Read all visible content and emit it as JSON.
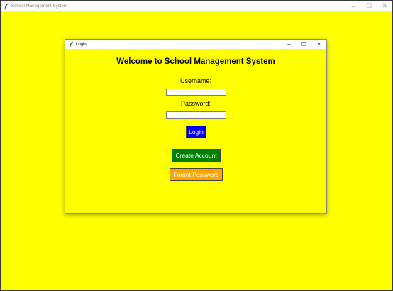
{
  "main_window": {
    "title": "School Management System",
    "controls": [
      "–",
      "☐",
      "✕"
    ]
  },
  "login_window": {
    "title": "Login",
    "controls": [
      "–",
      "☐",
      "✕"
    ],
    "heading": "Welcome to School Management System",
    "username_label": "Username:",
    "username_value": "",
    "password_label": "Password:",
    "password_value": "",
    "login_button": "Login",
    "create_account_button": "Create Account",
    "forgot_password_button": "Forgot Password"
  },
  "colors": {
    "background": "#ffff00",
    "login_button": "#0000ff",
    "create_account_button": "#008000",
    "forgot_password_button": "#ffa500"
  },
  "icons": {
    "window_icon": "feather-icon"
  }
}
